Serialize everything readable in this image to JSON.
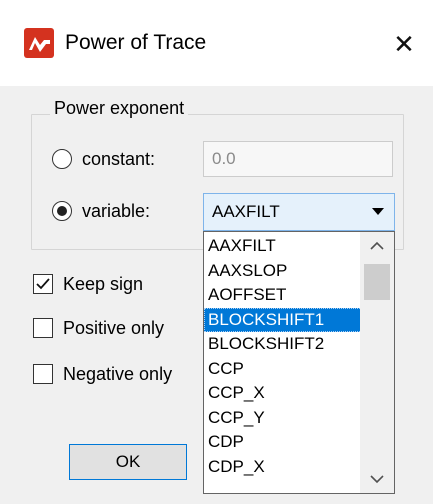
{
  "window": {
    "title": "Power of Trace",
    "close_glyph": "✕"
  },
  "group": {
    "title": "Power exponent"
  },
  "constant": {
    "label": "constant:",
    "value": "0.0",
    "checked": false
  },
  "variable": {
    "label": "variable:",
    "selected": "AAXFILT",
    "checked": true
  },
  "dropdown": {
    "items": [
      "AAXFILT",
      "AAXSLOP",
      "AOFFSET",
      "BLOCKSHIFT1",
      "BLOCKSHIFT2",
      "CCP",
      "CCP_X",
      "CCP_Y",
      "CDP",
      "CDP_X"
    ],
    "highlighted": "BLOCKSHIFT1"
  },
  "options": {
    "keep_sign": {
      "label": "Keep sign",
      "checked": true
    },
    "positive_only": {
      "label": "Positive only",
      "checked": false
    },
    "negative_only": {
      "label": "Negative only",
      "checked": false
    }
  },
  "buttons": {
    "ok": "OK"
  },
  "colors": {
    "accent": "#0078d7",
    "app_icon": "#d4321f"
  },
  "icons": {
    "app": "trace-logo-icon",
    "close": "close-icon",
    "combo_arrow": "chevron-down-icon"
  }
}
